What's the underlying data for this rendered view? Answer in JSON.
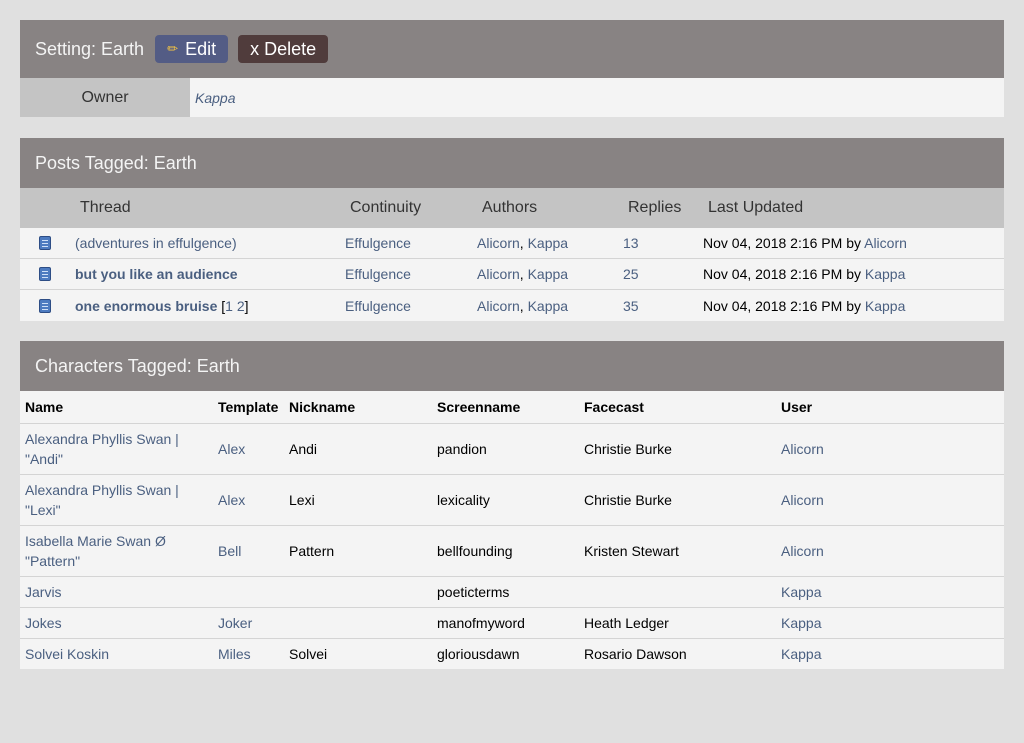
{
  "setting": {
    "title": "Setting: Earth",
    "edit_label": "Edit",
    "delete_label": "x Delete",
    "owner_label": "Owner",
    "owner_value": "Kappa"
  },
  "posts": {
    "title": "Posts Tagged: Earth",
    "headers": [
      "Thread",
      "Continuity",
      "Authors",
      "Replies",
      "Last Updated"
    ],
    "rows": [
      {
        "thread": "(adventures in effulgence)",
        "bold": false,
        "pages": [],
        "continuity": "Effulgence",
        "author1": "Alicorn",
        "author2": "Kappa",
        "replies": "13",
        "updated": "Nov 04, 2018 2:16 PM by ",
        "updated_by": "Alicorn"
      },
      {
        "thread": "but you like an audience",
        "bold": true,
        "pages": [],
        "continuity": "Effulgence",
        "author1": "Alicorn",
        "author2": "Kappa",
        "replies": "25",
        "updated": "Nov 04, 2018 2:16 PM by ",
        "updated_by": "Kappa"
      },
      {
        "thread": "one enormous bruise",
        "bold": true,
        "pages": [
          "1",
          "2"
        ],
        "continuity": "Effulgence",
        "author1": "Alicorn",
        "author2": "Kappa",
        "replies": "35",
        "updated": "Nov 04, 2018 2:16 PM by ",
        "updated_by": "Kappa"
      }
    ]
  },
  "characters": {
    "title": "Characters Tagged: Earth",
    "headers": [
      "Name",
      "Template",
      "Nickname",
      "Screenname",
      "Facecast",
      "User"
    ],
    "rows": [
      {
        "name": "Alexandra Phyllis Swan | \"Andi\"",
        "template": "Alex",
        "nickname": "Andi",
        "screenname": "pandion",
        "facecast": "Christie Burke",
        "user": "Alicorn"
      },
      {
        "name": "Alexandra Phyllis Swan | \"Lexi\"",
        "template": "Alex",
        "nickname": "Lexi",
        "screenname": "lexicality",
        "facecast": "Christie Burke",
        "user": "Alicorn"
      },
      {
        "name": "Isabella Marie Swan Ø \"Pattern\"",
        "template": "Bell",
        "nickname": "Pattern",
        "screenname": "bellfounding",
        "facecast": "Kristen Stewart",
        "user": "Alicorn"
      },
      {
        "name": "Jarvis",
        "template": "",
        "nickname": "",
        "screenname": "poeticterms",
        "facecast": "",
        "user": "Kappa"
      },
      {
        "name": "Jokes",
        "template": "Joker",
        "nickname": "",
        "screenname": "manofmyword",
        "facecast": "Heath Ledger",
        "user": "Kappa"
      },
      {
        "name": "Solvei Koskin",
        "template": "Miles",
        "nickname": "Solvei",
        "screenname": "gloriousdawn",
        "facecast": "Rosario Dawson",
        "user": "Kappa"
      }
    ]
  }
}
